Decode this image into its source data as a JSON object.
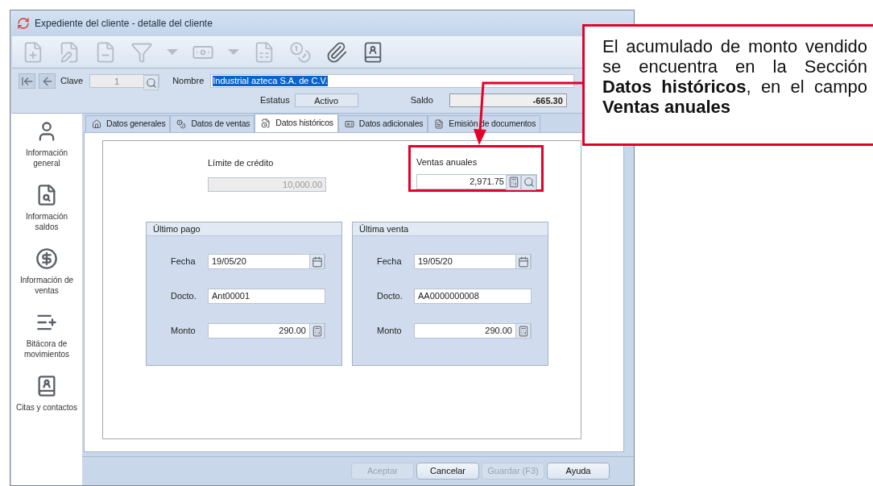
{
  "window": {
    "title": "Expediente del cliente - detalle del cliente"
  },
  "toolbar": [
    {
      "kind": "add-doc",
      "disabled": true
    },
    {
      "kind": "edit-doc",
      "disabled": true
    },
    {
      "kind": "remove-doc",
      "disabled": true
    },
    {
      "kind": "filter",
      "disabled": true
    },
    {
      "kind": "caret",
      "disabled": true
    },
    {
      "kind": "money",
      "disabled": true
    },
    {
      "kind": "caret",
      "disabled": true
    },
    {
      "kind": "calendar-doc",
      "disabled": true
    },
    {
      "kind": "coins",
      "disabled": true
    },
    {
      "kind": "attach",
      "disabled": false
    },
    {
      "kind": "contacts",
      "disabled": false
    }
  ],
  "record": {
    "clave_label": "Clave",
    "clave": "1",
    "nombre_label": "Nombre",
    "nombre": "Industrial azteca S.A. de C.V.",
    "estatus_label": "Estatus",
    "estatus": "Activo",
    "saldo_label": "Saldo",
    "saldo": "-665.30"
  },
  "sidebar": [
    {
      "kind": "person",
      "label": "Información general"
    },
    {
      "kind": "balance",
      "label": "Información saldos"
    },
    {
      "kind": "sales",
      "label": "Información de ventas"
    },
    {
      "kind": "log",
      "label": "Bitácora de movimientos"
    },
    {
      "kind": "contacts",
      "label": "Citas y contactos"
    }
  ],
  "tabs": [
    {
      "kind": "home",
      "label": "Datos generales",
      "selected": false
    },
    {
      "kind": "sales",
      "label": "Datos de ventas",
      "selected": false
    },
    {
      "kind": "history",
      "label": "Datos históricos",
      "selected": true
    },
    {
      "kind": "extra",
      "label": "Datos adicionales",
      "selected": false
    },
    {
      "kind": "docs",
      "label": "Emisión de documentos",
      "selected": false
    }
  ],
  "credit_limit": {
    "label": "Límite de crédito",
    "value": "10,000.00",
    "disabled": true
  },
  "annual_sales": {
    "label": "Ventas anuales",
    "value": "2,971.75",
    "highlighted": true
  },
  "groups": [
    {
      "title": "Último pago",
      "fields": [
        {
          "kind": "date",
          "label": "Fecha",
          "value": "19/05/20"
        },
        {
          "kind": "text",
          "label": "Docto.",
          "value": "Ant00001"
        },
        {
          "kind": "amount",
          "label": "Monto",
          "value": "290.00"
        }
      ]
    },
    {
      "title": "Última venta",
      "fields": [
        {
          "kind": "date",
          "label": "Fecha",
          "value": "19/05/20"
        },
        {
          "kind": "text",
          "label": "Docto.",
          "value": "AA0000000008"
        },
        {
          "kind": "amount",
          "label": "Monto",
          "value": "290.00"
        }
      ]
    }
  ],
  "buttons": [
    {
      "label": "Aceptar",
      "disabled": true
    },
    {
      "label": "Cancelar",
      "disabled": false
    },
    {
      "label": "Guardar (F3)",
      "disabled": true
    },
    {
      "label": "Ayuda",
      "disabled": false
    }
  ],
  "callout": {
    "text": "El acumulado de monto vendido se encuentra en la Sección **Datos históricos**, en el campo **Ventas anuales**"
  }
}
